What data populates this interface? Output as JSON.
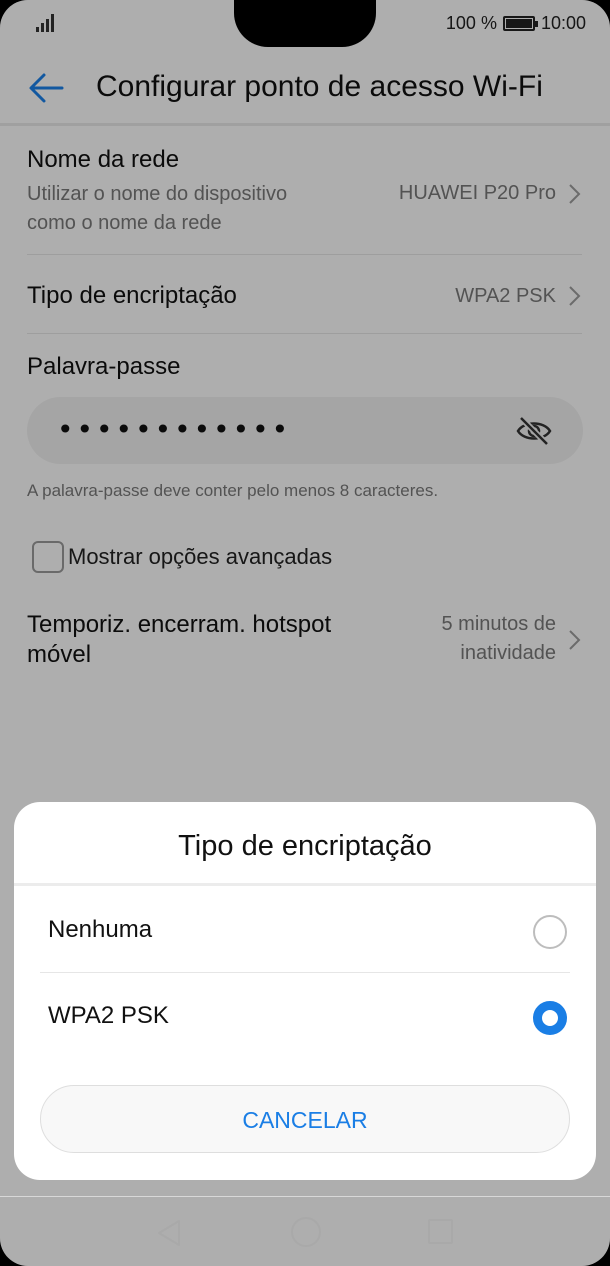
{
  "status_bar": {
    "battery_percent": "100 %",
    "time": "10:00"
  },
  "header": {
    "title": "Configurar ponto de acesso Wi-Fi",
    "back_icon": "arrow-left-icon",
    "accent_color": "#1a7ee5"
  },
  "settings": {
    "network_name": {
      "label": "Nome da rede",
      "sublabel_line1": "Utilizar o nome do dispositivo",
      "sublabel_line2": "como o nome da rede",
      "value": "HUAWEI P20 Pro"
    },
    "encryption": {
      "label": "Tipo de encriptação",
      "value": "WPA2 PSK"
    },
    "password": {
      "label": "Palavra-passe",
      "masked_value": "••••••••••••",
      "toggle_icon": "eye-off-icon",
      "hint": "A palavra-passe deve conter pelo menos 8 caracteres."
    },
    "advanced": {
      "label": "Mostrar opções avançadas",
      "checked": false
    },
    "timeout": {
      "label_line1": "Temporiz. encerram. hotspot",
      "label_line2": "móvel",
      "value_line1": "5 minutos de",
      "value_line2": "inatividade"
    }
  },
  "dialog": {
    "title": "Tipo de encriptação",
    "options": [
      {
        "label": "Nenhuma",
        "selected": false
      },
      {
        "label": "WPA2 PSK",
        "selected": true
      }
    ],
    "cancel_label": "CANCELAR"
  },
  "nav_bar": {
    "icons": [
      "back-triangle-icon",
      "home-circle-icon",
      "recents-square-icon"
    ]
  }
}
